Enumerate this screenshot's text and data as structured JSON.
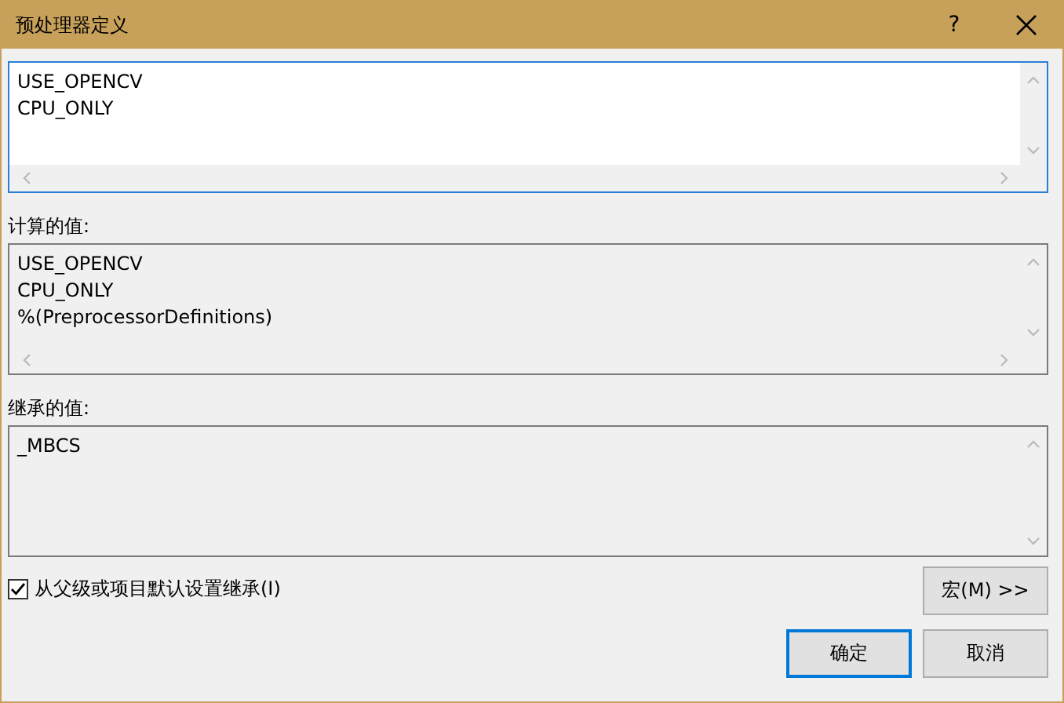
{
  "window": {
    "title": "预处理器定义",
    "help": "?"
  },
  "boxes": [
    {
      "kind": "editable",
      "lines": [
        "USE_OPENCV",
        "CPU_ONLY"
      ],
      "horizontal_scroll": true
    },
    {
      "kind": "readonly",
      "label": "计算的值:",
      "lines": [
        "USE_OPENCV",
        "CPU_ONLY",
        "%(PreprocessorDefinitions)"
      ],
      "horizontal_scroll": true
    },
    {
      "kind": "readonly",
      "label": "继承的值:",
      "lines": [
        "_MBCS"
      ],
      "horizontal_scroll": false
    }
  ],
  "inherit_checkbox": {
    "label": "从父级或项目默认设置继承(I)",
    "checked": true
  },
  "macro_button": "宏(M) >>",
  "buttons": [
    {
      "label": "确定",
      "default": true
    },
    {
      "label": "取消",
      "default": false
    }
  ]
}
